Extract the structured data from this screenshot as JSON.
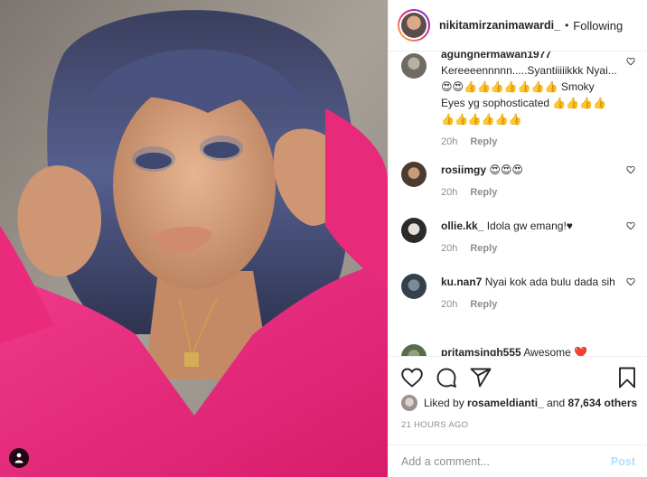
{
  "header": {
    "username": "nikitamirzanimawardi_",
    "separator": "•",
    "follow_status": "Following"
  },
  "comments": [
    {
      "username": "agungnermawan1977",
      "text": "Kereeeennnnn.....Syantiiiiikkk Nyai...😍😍👍👍👍👍👍👍👍 Smoky Eyes yg sophosticated 👍👍👍👍👍👍👍👍👍👍",
      "time": "20h",
      "reply": "Reply"
    },
    {
      "username": "rosiimgy",
      "text": "😍😍😍",
      "time": "20h",
      "reply": "Reply"
    },
    {
      "username": "ollie.kk_",
      "text": "Idola gw emang!♥",
      "time": "20h",
      "reply": "Reply"
    },
    {
      "username": "ku.nan7",
      "text": "Nyai kok ada bulu dada sih",
      "time": "20h",
      "reply": "Reply"
    },
    {
      "username": "pritamsingh555",
      "text": "Awesome ❤️"
    }
  ],
  "likes": {
    "prefix": "Liked by",
    "user": "rosameldianti_",
    "and": "and",
    "count": "87,634 others"
  },
  "timestamp": "21 HOURS AGO",
  "add_comment": {
    "placeholder": "Add a comment...",
    "post_label": "Post"
  },
  "colors": {
    "shirt": "#e8287a",
    "hair": "#4d5785",
    "link_disabled": "#b2dffc"
  }
}
